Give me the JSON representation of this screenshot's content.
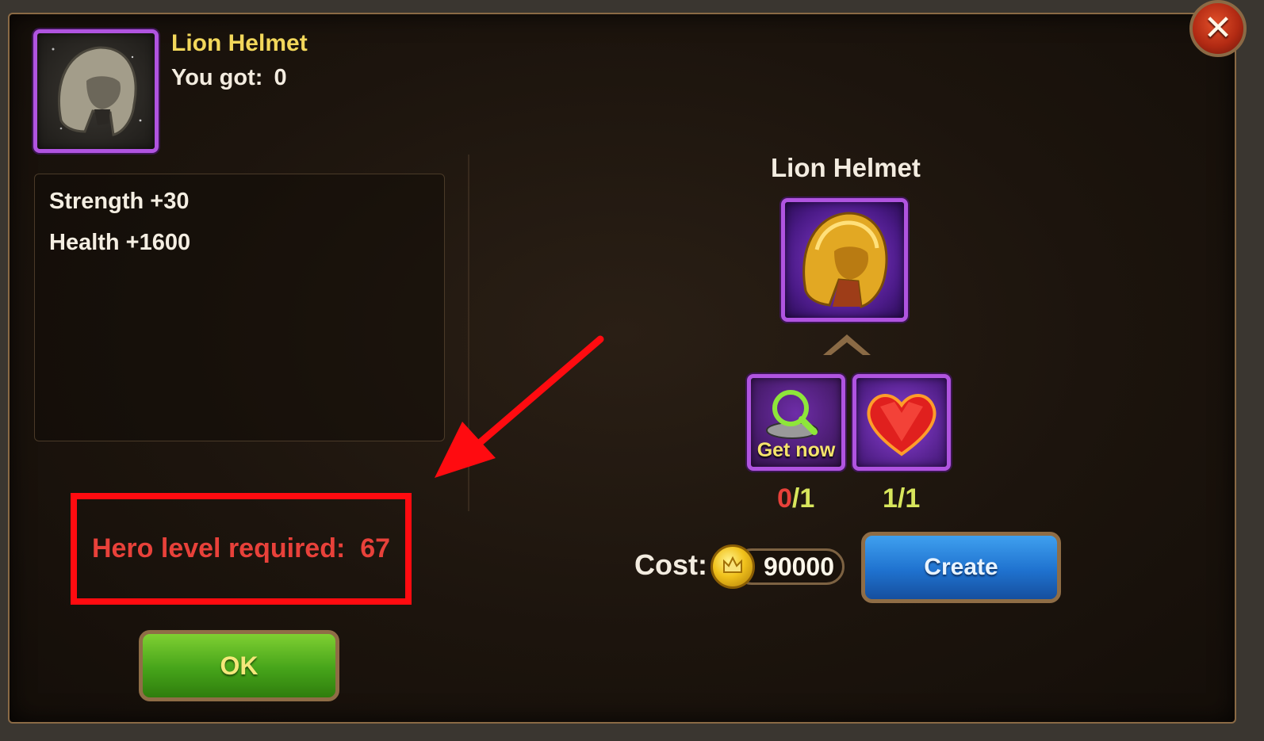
{
  "dialog": {
    "item_name": "Lion Helmet",
    "owned_label": "You got:",
    "owned_count": "0",
    "stats": [
      "Strength +30",
      "Health +1600"
    ],
    "requirement": "Hero level required:  67",
    "ok_label": "OK",
    "close_icon": "close-icon"
  },
  "crafting": {
    "result_name": "Lion Helmet",
    "materials": [
      {
        "icon": "magnifier-icon",
        "label": "Get now",
        "have": "0",
        "need": "/1",
        "have_color": "#e8413a"
      },
      {
        "icon": "ruby-heart-icon",
        "label": "",
        "have": "1",
        "need": "/1",
        "have_color": "#d8e65c"
      }
    ],
    "cost_label": "Cost:",
    "cost_value": "90000",
    "cost_icon": "gold-coin-icon",
    "create_label": "Create"
  },
  "colors": {
    "highlight_box": "#ff0b10",
    "annotation_arrow": "#ff0b10",
    "ok_button": "#46a41a",
    "create_button": "#1f72cf"
  }
}
